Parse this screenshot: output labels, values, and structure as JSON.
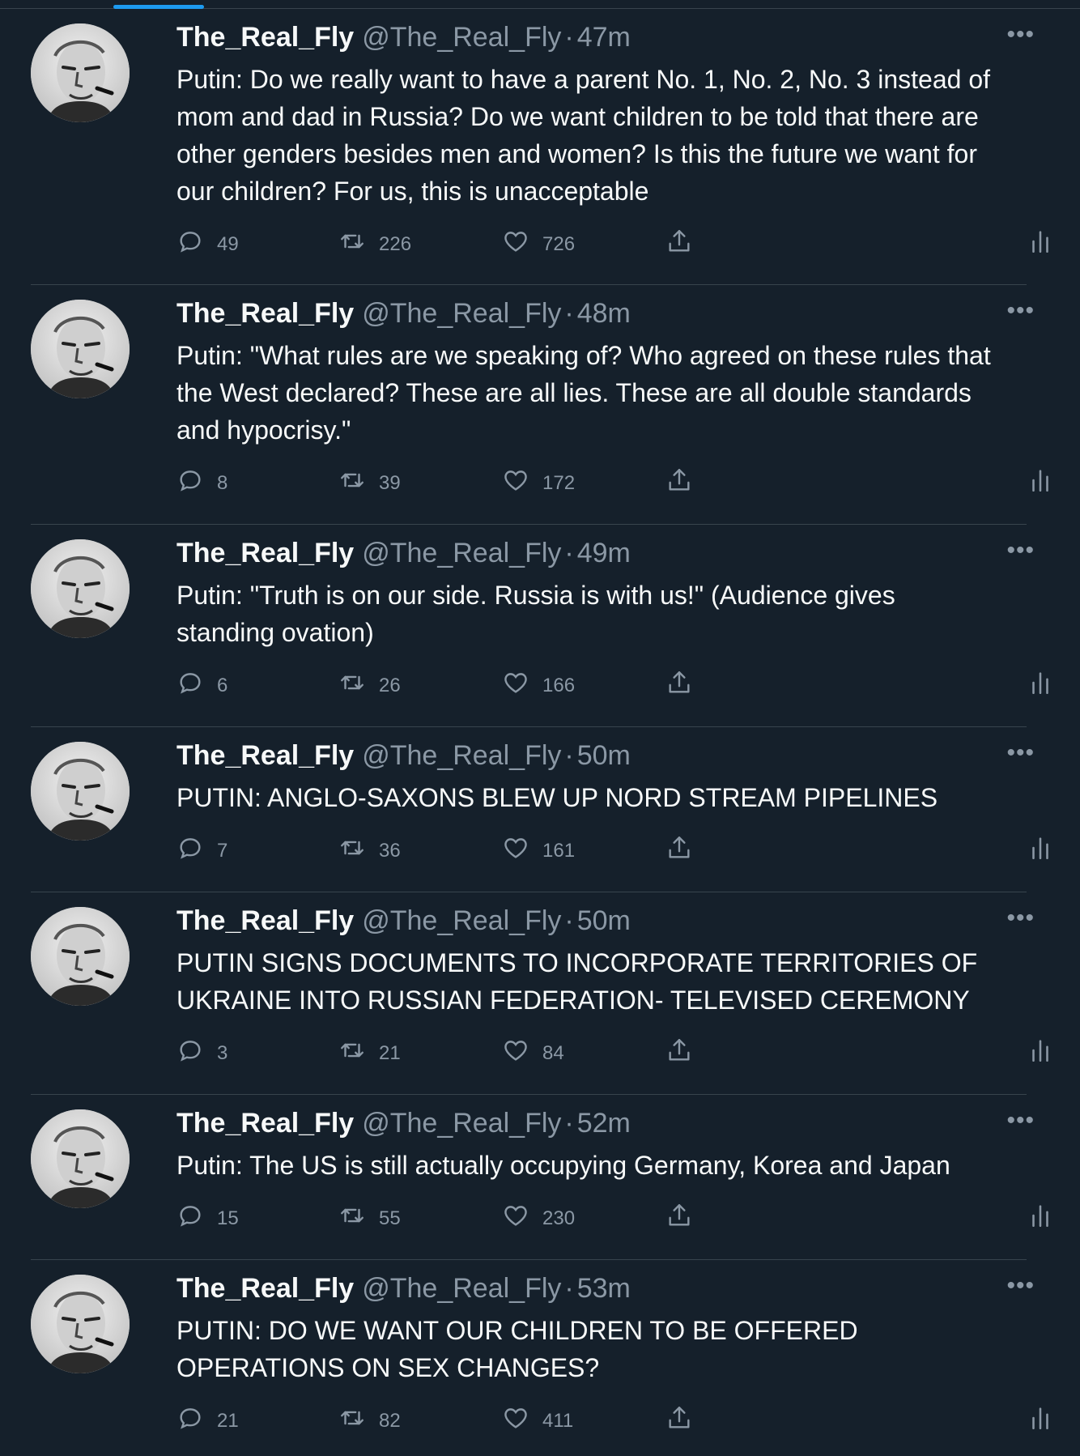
{
  "colors": {
    "background": "#15202b",
    "text": "#f7f9f9",
    "muted": "#8b98a5",
    "accent": "#1d9bf0",
    "divider": "#38444d"
  },
  "tweets": [
    {
      "name": "The_Real_Fly",
      "handle": "@The_Real_Fly",
      "dot": "·",
      "time": "47m",
      "text": "Putin: Do we really want to have a parent No. 1, No. 2, No. 3 instead of mom and dad in Russia? Do we want children to be told that there are other genders besides men and women? Is this the future we want for our children? For us, this is unacceptable",
      "replies": "49",
      "retweets": "226",
      "likes": "726"
    },
    {
      "name": "The_Real_Fly",
      "handle": "@The_Real_Fly",
      "dot": "·",
      "time": "48m",
      "text": "Putin: \"What rules are we speaking of? Who agreed on these rules that the West declared? These are all lies. These are all double standards and hypocrisy.\"",
      "replies": "8",
      "retweets": "39",
      "likes": "172"
    },
    {
      "name": "The_Real_Fly",
      "handle": "@The_Real_Fly",
      "dot": "·",
      "time": "49m",
      "text": "Putin: \"Truth is on our side. Russia is with us!\" (Audience gives standing ovation)",
      "replies": "6",
      "retweets": "26",
      "likes": "166"
    },
    {
      "name": "The_Real_Fly",
      "handle": "@The_Real_Fly",
      "dot": "·",
      "time": "50m",
      "text": "PUTIN: ANGLO-SAXONS BLEW UP NORD STREAM PIPELINES",
      "replies": "7",
      "retweets": "36",
      "likes": "161"
    },
    {
      "name": "The_Real_Fly",
      "handle": "@The_Real_Fly",
      "dot": "·",
      "time": "50m",
      "text": "PUTIN SIGNS DOCUMENTS TO INCORPORATE TERRITORIES OF UKRAINE INTO RUSSIAN FEDERATION- TELEVISED CEREMONY",
      "replies": "3",
      "retweets": "21",
      "likes": "84"
    },
    {
      "name": "The_Real_Fly",
      "handle": "@The_Real_Fly",
      "dot": "·",
      "time": "52m",
      "text": "Putin: The US is still actually occupying Germany, Korea and Japan",
      "replies": "15",
      "retweets": "55",
      "likes": "230"
    },
    {
      "name": "The_Real_Fly",
      "handle": "@The_Real_Fly",
      "dot": "·",
      "time": "53m",
      "text": "PUTIN: DO WE WANT OUR CHILDREN TO BE OFFERED OPERATIONS ON SEX CHANGES?",
      "replies": "21",
      "retweets": "82",
      "likes": "411"
    }
  ],
  "icons": {
    "reply": "reply-icon",
    "retweet": "retweet-icon",
    "like": "heart-icon",
    "share": "share-icon",
    "analytics": "analytics-icon",
    "more": "more-icon"
  }
}
